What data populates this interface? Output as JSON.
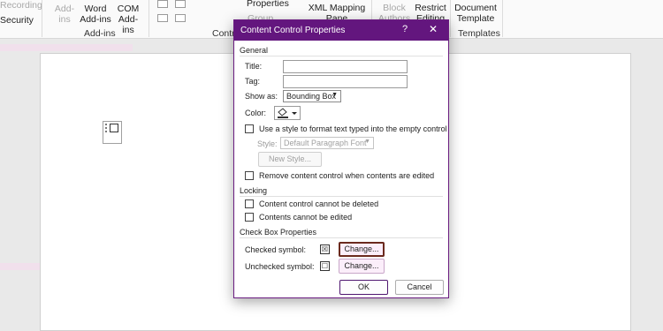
{
  "ribbon": {
    "recording": "Recording",
    "security": "Security",
    "addins_1": "Add-",
    "addins_2": "ins",
    "word_1": "Word",
    "word_2": "Add-ins",
    "com_1": "COM",
    "com_2": "Add-ins",
    "group_addins": "Add-ins",
    "group_controls": "Contro",
    "properties": "Properties",
    "group_btn": "Group",
    "xml_1": "XML Mapping",
    "xml_2": "Pane",
    "block_1": "Block",
    "block_2": "Authors",
    "restrict_1": "Restrict",
    "restrict_2": "Editing",
    "doc_1": "Document",
    "doc_2": "Template",
    "group_templates": "Templates"
  },
  "dialog": {
    "title": "Content Control Properties",
    "help": "?",
    "close": "✕",
    "general": "General",
    "title_label": "Title:",
    "tag_label": "Tag:",
    "show_as_label": "Show as:",
    "show_as_value": "Bounding Box",
    "color_label": "Color:",
    "use_style": "Use a style to format text typed into the empty control",
    "style_label": "Style:",
    "style_value": "Default Paragraph Font",
    "new_style": "New Style...",
    "remove_control": "Remove content control when contents are edited",
    "locking": "Locking",
    "cannot_delete": "Content control cannot be deleted",
    "cannot_edit": "Contents cannot be edited",
    "checkbox_props": "Check Box Properties",
    "checked_symbol": "Checked symbol:",
    "checked_glyph": "☒",
    "unchecked_symbol": "Unchecked symbol:",
    "unchecked_glyph": "☐",
    "change_1": "Change...",
    "change_2": "Change...",
    "ok": "OK",
    "cancel": "Cancel"
  },
  "colors": {
    "titlebar": "#63167e",
    "accent_border": "#6b2a1e"
  }
}
